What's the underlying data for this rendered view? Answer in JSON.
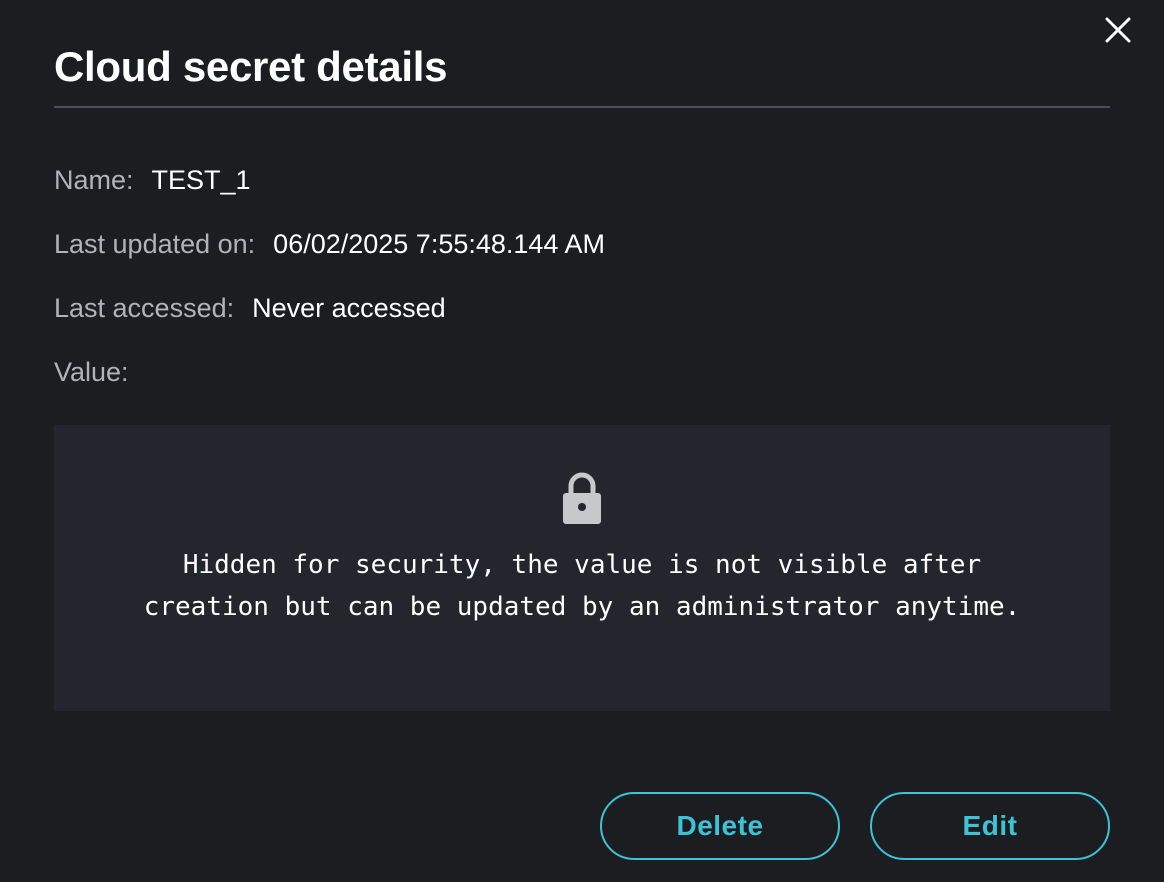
{
  "dialog": {
    "title": "Cloud secret details",
    "close_icon": "close-icon"
  },
  "fields": {
    "name": {
      "label": "Name:",
      "value": "TEST_1"
    },
    "last_updated": {
      "label": "Last updated on:",
      "value": "06/02/2025 7:55:48.144 AM"
    },
    "last_accessed": {
      "label": "Last accessed:",
      "value": "Never accessed"
    },
    "value": {
      "label": "Value:"
    }
  },
  "value_panel": {
    "icon": "lock-icon",
    "message_line1": "Hidden for security, the value is not visible after",
    "message_line2": "creation but can be updated by an administrator anytime."
  },
  "actions": {
    "delete_label": "Delete",
    "edit_label": "Edit"
  },
  "colors": {
    "background": "#1b1d21",
    "panel": "#24262d",
    "accent": "#3cc3d6",
    "label": "#b0b3b8",
    "text": "#ffffff"
  }
}
